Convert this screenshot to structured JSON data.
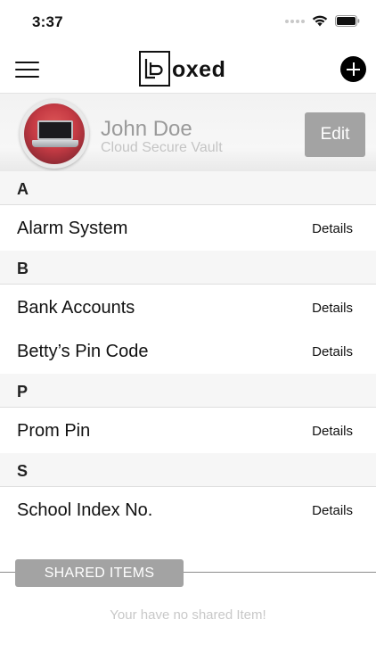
{
  "status_bar": {
    "time": "3:37"
  },
  "nav": {
    "logo_text": "oxed"
  },
  "profile": {
    "name": "John Doe",
    "subtitle": "Cloud Secure Vault",
    "edit_label": "Edit"
  },
  "sections": [
    {
      "letter": "A",
      "items": [
        {
          "title": "Alarm System",
          "action": "Details"
        }
      ]
    },
    {
      "letter": "B",
      "items": [
        {
          "title": "Bank Accounts",
          "action": "Details"
        },
        {
          "title": "Betty’s Pin Code",
          "action": "Details"
        }
      ]
    },
    {
      "letter": "P",
      "items": [
        {
          "title": "Prom Pin",
          "action": "Details"
        }
      ]
    },
    {
      "letter": "S",
      "items": [
        {
          "title": "School Index No.",
          "action": "Details"
        }
      ]
    }
  ],
  "shared": {
    "tab_label": "SHARED ITEMS",
    "empty_message": "Your have no shared Item!"
  },
  "colors": {
    "accent_gray": "#a3a3a3",
    "text": "#111111"
  }
}
